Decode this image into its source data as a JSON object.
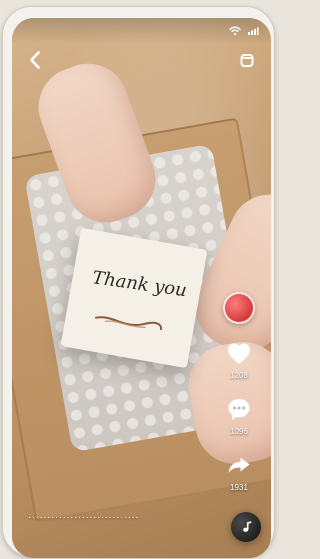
{
  "note": {
    "text": "Thank you"
  },
  "actions": {
    "like_count": "1208",
    "comment_count": "1096",
    "share_count": "1931"
  },
  "caption": {
    "text": "·····························"
  },
  "colors": {
    "white": "#ffffff",
    "cardboard": "#c49b6f",
    "avatar_red": "#c11f1f"
  },
  "icons": {
    "back": "back-icon",
    "menu": "menu-icon",
    "like": "heart-icon",
    "comment": "comment-icon",
    "share": "share-icon",
    "music": "music-note-icon"
  }
}
